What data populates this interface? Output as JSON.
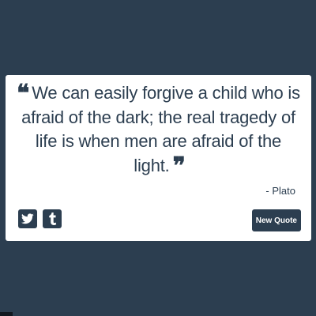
{
  "quote": {
    "open_mark": "❝",
    "text": "We can easily forgive a child who is afraid of the dark; the real tragedy of life is when men are afraid of the light.",
    "close_mark": "❞",
    "author": "- Plato"
  },
  "share": {
    "twitter_icon": "twitter-bird",
    "tumblr_icon": "tumblr-t"
  },
  "actions": {
    "new_quote_label": "New Quote"
  },
  "colors": {
    "background": "#2c3e50",
    "card": "#ffffff",
    "text": "#2c3e50"
  }
}
